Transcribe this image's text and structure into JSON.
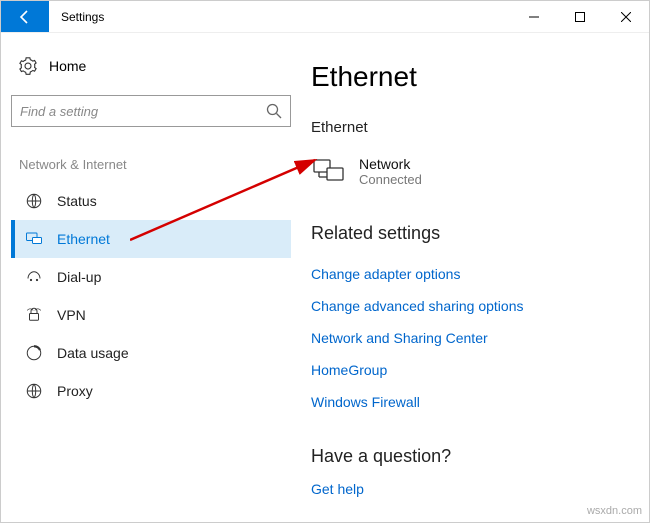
{
  "titlebar": {
    "title": "Settings"
  },
  "sidebar": {
    "home_label": "Home",
    "search_placeholder": "Find a setting",
    "group_label": "Network & Internet",
    "items": [
      {
        "label": "Status"
      },
      {
        "label": "Ethernet"
      },
      {
        "label": "Dial-up"
      },
      {
        "label": "VPN"
      },
      {
        "label": "Data usage"
      },
      {
        "label": "Proxy"
      }
    ]
  },
  "main": {
    "heading": "Ethernet",
    "section_label": "Ethernet",
    "network": {
      "name": "Network",
      "status": "Connected"
    },
    "related_heading": "Related settings",
    "related_links": [
      "Change adapter options",
      "Change advanced sharing options",
      "Network and Sharing Center",
      "HomeGroup",
      "Windows Firewall"
    ],
    "question_heading": "Have a question?",
    "question_link": "Get help"
  },
  "watermark": "wsxdn.com"
}
